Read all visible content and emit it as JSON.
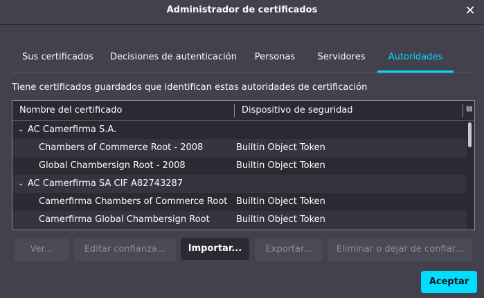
{
  "window": {
    "title": "Administrador de certificados",
    "close_icon": "close-icon"
  },
  "tabs": [
    {
      "label": "Sus certificados",
      "active": false
    },
    {
      "label": "Decisiones de autenticación",
      "active": false
    },
    {
      "label": "Personas",
      "active": false
    },
    {
      "label": "Servidores",
      "active": false
    },
    {
      "label": "Autoridades",
      "active": true
    }
  ],
  "intro_text": "Tiene certificados guardados que identifican estas autoridades de certificación",
  "table": {
    "columns": [
      "Nombre del certificado",
      "Dispositivo de seguridad"
    ],
    "rows": [
      {
        "name": "AC Camerfirma S.A.",
        "device": "",
        "group": true
      },
      {
        "name": "Chambers of Commerce Root - 2008",
        "device": "Builtin Object Token",
        "group": false
      },
      {
        "name": "Global Chambersign Root - 2008",
        "device": "Builtin Object Token",
        "group": false
      },
      {
        "name": "AC Camerfirma SA CIF A82743287",
        "device": "",
        "group": true
      },
      {
        "name": "Camerfirma Chambers of Commerce Root",
        "device": "Builtin Object Token",
        "group": false
      },
      {
        "name": "Camerfirma Global Chambersign Root",
        "device": "Builtin Object Token",
        "group": false
      }
    ]
  },
  "buttons": {
    "view": "Ver...",
    "edit_trust": "Editar confianza...",
    "import": "Importar...",
    "export": "Exportar...",
    "delete": "Eliminar o dejar de confiar...",
    "accept": "Aceptar"
  },
  "colors": {
    "accent": "#00ddff",
    "background": "#42414d",
    "panel": "#2b2a33"
  }
}
